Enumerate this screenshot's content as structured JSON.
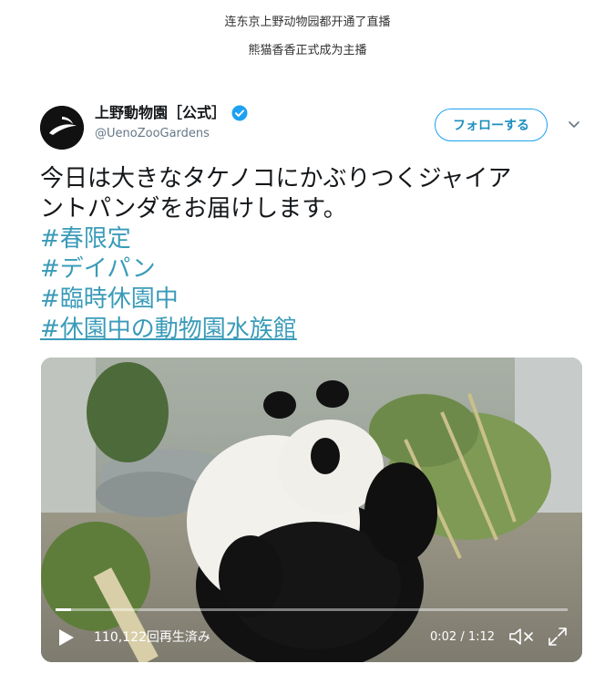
{
  "article": {
    "line1": "连东京上野动物园都开通了直播",
    "line2": "熊猫香香正式成为主播"
  },
  "tweet": {
    "author_name": "上野動物園［公式］",
    "author_handle": "@UenoZooGardens",
    "follow_label": "フォローする",
    "text_line1": "今日は大きなタケノコにかぶりつくジャイア",
    "text_line2": "ントパンダをお届けします。",
    "hashtags": [
      "#春限定",
      "#デイパン",
      "#臨時休園中",
      "#休園中の動物園水族館"
    ]
  },
  "video": {
    "view_count": "110,122回再生済み",
    "time": "0:02 / 1:12",
    "progress": 0.03
  },
  "colors": {
    "accent": "#1da1f2",
    "hashtag": "#3a9bb8",
    "verified": "#1da1f2"
  },
  "icons": {
    "verified": "verified-badge-icon",
    "chevron": "chevron-down-icon",
    "play": "play-icon",
    "mute": "mute-icon",
    "fullscreen": "fullscreen-icon"
  }
}
